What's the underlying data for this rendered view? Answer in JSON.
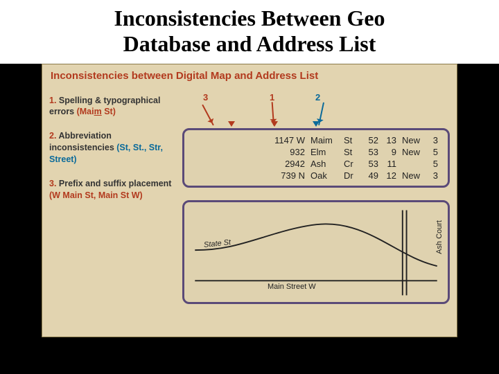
{
  "slide_title_l1": "Inconsistencies Between Geo",
  "slide_title_l2": "Database and Address List",
  "diagram_title": "Inconsistencies between Digital Map and Address List",
  "legend": [
    {
      "num": "1.",
      "lead": "Spelling & typographical errors ",
      "hl": "(Maim St)",
      "color": "red"
    },
    {
      "num": "2.",
      "lead": "Abbreviation inconsistencies ",
      "hl": "(St, St., Str, Street)",
      "color": "blue"
    },
    {
      "num": "3.",
      "lead": "Prefix and suffix placement ",
      "hl": "(W Main St, Main St W)",
      "color": "red"
    }
  ],
  "callout_numbers": {
    "n3": "3",
    "n1": "1",
    "n2": "2"
  },
  "table": [
    {
      "addr": "1147 W",
      "name": "Maim",
      "sfx": "St",
      "a": "52",
      "b": "13",
      "c": "New",
      "d": "3"
    },
    {
      "addr": "932",
      "name": "Elm",
      "sfx": "St",
      "a": "53",
      "b": "9",
      "c": "New",
      "d": "5"
    },
    {
      "addr": "2942",
      "name": "Ash",
      "sfx": "Cr",
      "a": "53",
      "b": "11",
      "c": "",
      "d": "5"
    },
    {
      "addr": "739 N",
      "name": "Oak",
      "sfx": "Dr",
      "a": "49",
      "b": "12",
      "c": "New",
      "d": "3"
    }
  ],
  "map": {
    "state_st": "State St",
    "main_w": "Main Street W",
    "ash_ct": "Ash Court"
  }
}
